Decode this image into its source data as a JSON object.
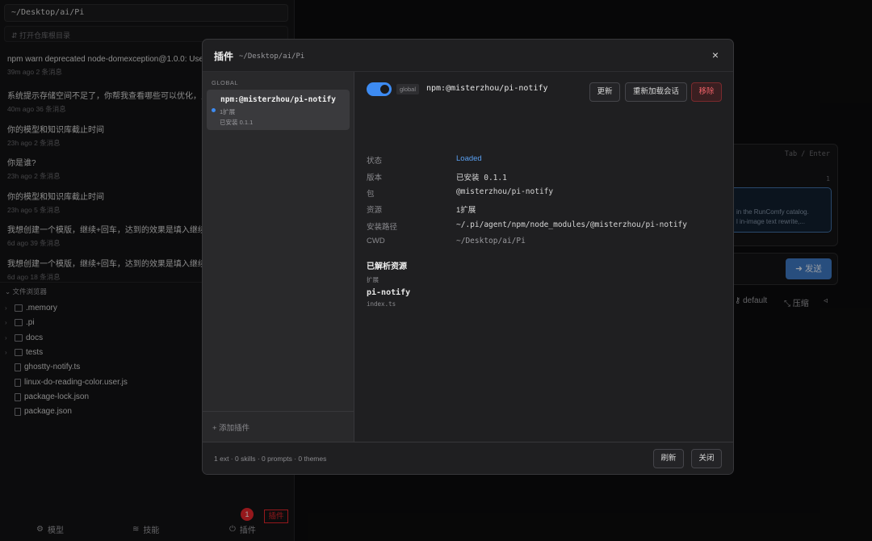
{
  "sidebar": {
    "path": "~/Desktop/ai/Pi",
    "open_repo": "⇵ 打开仓库根目录",
    "sessions": [
      {
        "title": "npm warn deprecated node-domexception@1.0.0: Use y",
        "meta": "39m ago   2 条消息"
      },
      {
        "title": "系统提示存储空间不足了，你帮我查看哪些可以优化，只列",
        "meta": "40m ago   36 条消息"
      },
      {
        "title": "你的模型和知识库截止时间",
        "meta": "23h ago   2 条消息"
      },
      {
        "title": "你是谁?",
        "meta": "23h ago   2 条消息"
      },
      {
        "title": "你的模型和知识库截止时间",
        "meta": "23h ago   5 条消息"
      },
      {
        "title": "我想创建一个模版，继续+回车，达到的效果是填入继续并自",
        "meta": "6d ago   39 条消息"
      },
      {
        "title": "我想创建一个模版，继续+回车，达到的效果是填入继续并自",
        "meta": "6d ago   18 条消息"
      }
    ],
    "file_explorer": {
      "header": "文件浏览器",
      "items": [
        {
          "name": ".memory",
          "type": "folder"
        },
        {
          "name": ".pi",
          "type": "folder"
        },
        {
          "name": "docs",
          "type": "folder"
        },
        {
          "name": "tests",
          "type": "folder"
        },
        {
          "name": "ghostty-notify.ts",
          "type": "file"
        },
        {
          "name": "linux-do-reading-color.user.js",
          "type": "file"
        },
        {
          "name": "package-lock.json",
          "type": "file"
        },
        {
          "name": "package.json",
          "type": "file"
        }
      ]
    },
    "bottom_tabs": {
      "models": "模型",
      "skills": "技能",
      "plugins": "插件"
    },
    "badge_count": "1",
    "plugin_highlight": "插件"
  },
  "background": {
    "hint": "Tab / Enter",
    "line_number": "1",
    "preview_line1": "in the RunComfy catalog.",
    "preview_line2": "l in-image text rewrite,...",
    "send_label": "➜ 发送",
    "model_label": "default",
    "compress_label": "压缩"
  },
  "modal": {
    "title": "插件",
    "path": "~/Desktop/ai/Pi",
    "close": "×",
    "list_section": "GLOBAL",
    "plugin_card": {
      "name": "npm:@misterzhou/pi-notify",
      "ext": "1扩展",
      "installed": "已安装 0.1.1"
    },
    "add_plugin": "+   添加插件",
    "detail": {
      "scope_tag": "global",
      "package": "npm:@misterzhou/pi-notify",
      "buttons": {
        "update": "更新",
        "reload": "重新加载会话",
        "remove": "移除"
      },
      "rows": [
        {
          "label": "状态",
          "value": "Loaded"
        },
        {
          "label": "版本",
          "value": "已安装 0.1.1"
        },
        {
          "label": "包",
          "value": "@misterzhou/pi-notify"
        },
        {
          "label": "资源",
          "value": "1扩展"
        },
        {
          "label": "安装路径",
          "value": "~/.pi/agent/npm/node_modules/@misterzhou/pi-notify"
        },
        {
          "label": "CWD",
          "value": "~/Desktop/ai/Pi"
        }
      ],
      "resources_title": "已解析资源",
      "resources_category": "扩展",
      "resource_name": "pi-notify",
      "resource_file": "index.ts"
    },
    "footer": {
      "summary": "1 ext · 0 skills · 0 prompts · 0 themes",
      "refresh": "刷新",
      "close": "关闭"
    }
  },
  "colors": {
    "accent": "#3d8bf2",
    "danger": "#f06268",
    "badge": "#e5252b"
  }
}
